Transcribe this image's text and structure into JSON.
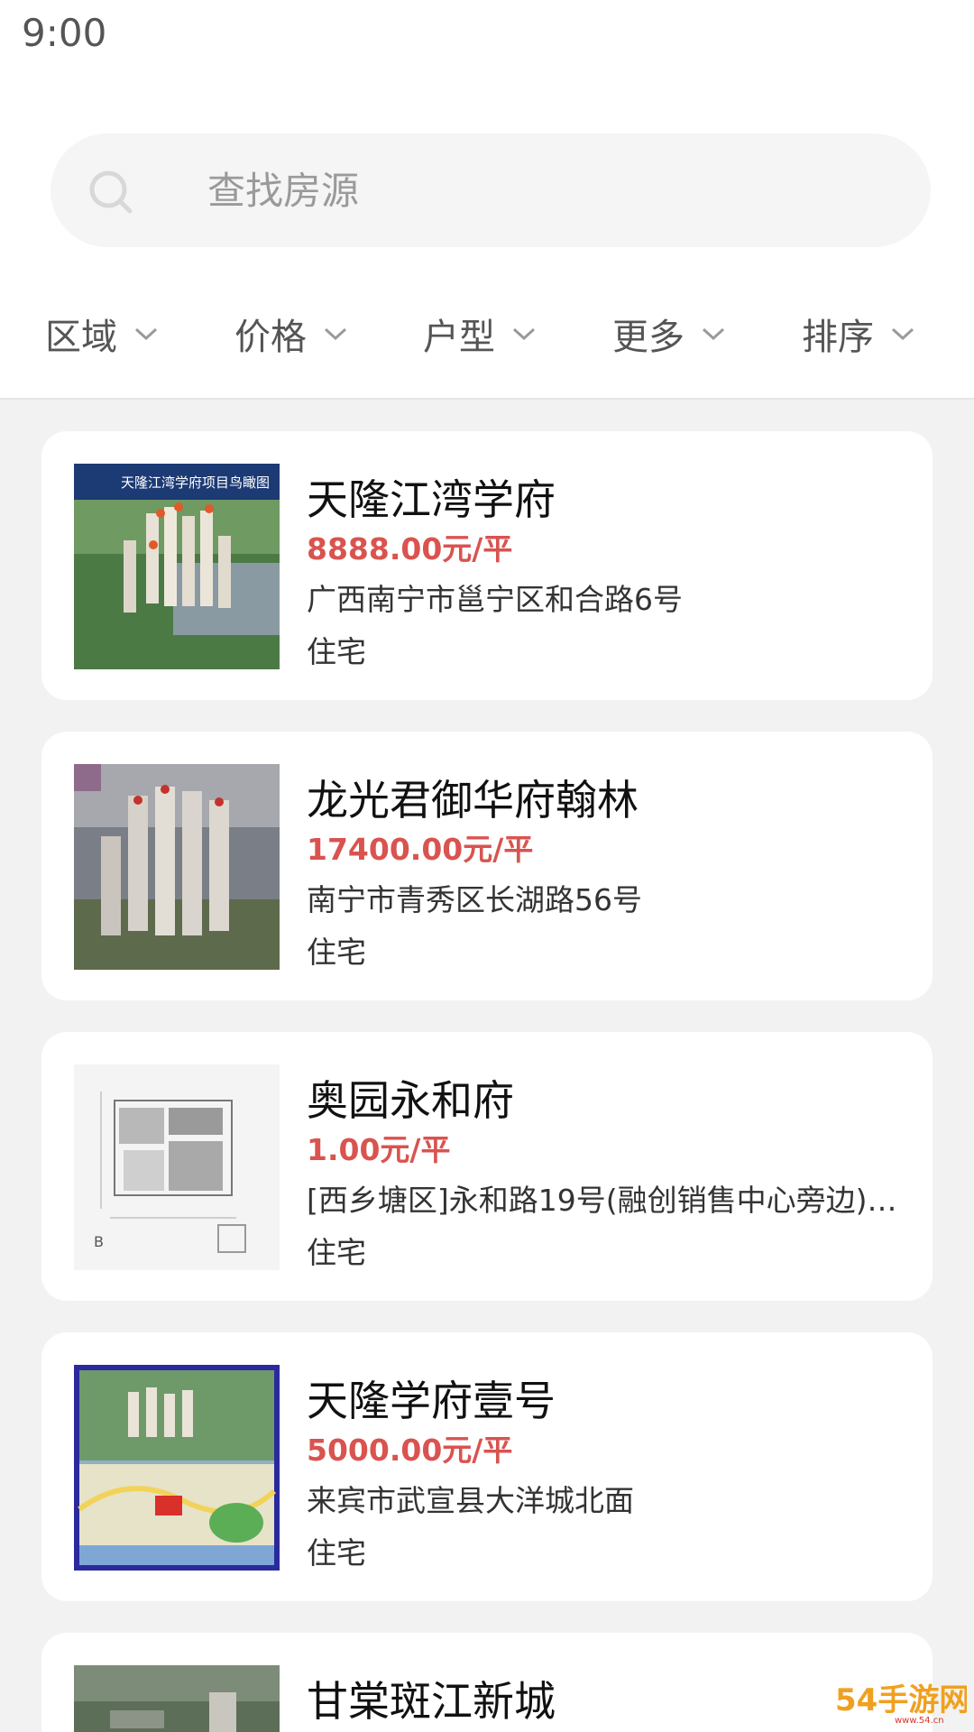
{
  "status_bar": {
    "time": "9:00"
  },
  "search": {
    "placeholder": "查找房源",
    "icon": "search-icon"
  },
  "filters": [
    {
      "label": "区域",
      "icon": "chevron-down-icon"
    },
    {
      "label": "价格",
      "icon": "chevron-down-icon"
    },
    {
      "label": "户型",
      "icon": "chevron-down-icon"
    },
    {
      "label": "更多",
      "icon": "chevron-down-icon"
    },
    {
      "label": "排序",
      "icon": "chevron-down-icon"
    }
  ],
  "listings": [
    {
      "title": "天隆江湾学府",
      "price": "8888.00元/平",
      "address": "广西南宁市邕宁区和合路6号",
      "type": "住宅",
      "image_banner": "天隆江湾学府项目鸟瞰图"
    },
    {
      "title": "龙光君御华府翰林",
      "price": "17400.00元/平",
      "address": "南宁市青秀区长湖路56号",
      "type": "住宅"
    },
    {
      "title": "奥园永和府",
      "price": "1.00元/平",
      "address": "[西乡塘区]永和路19号(融创销售中心旁边)旁边",
      "type": "住宅"
    },
    {
      "title": "天隆学府壹号",
      "price": "5000.00元/平",
      "address": "来宾市武宣县大洋城北面",
      "type": "住宅"
    },
    {
      "title": "甘棠斑江新城"
    }
  ],
  "colors": {
    "price": "#d9534f",
    "background": "#f2f2f2",
    "card": "#ffffff"
  },
  "watermark": {
    "text": "54手游网",
    "sub": "www.54.cn"
  }
}
